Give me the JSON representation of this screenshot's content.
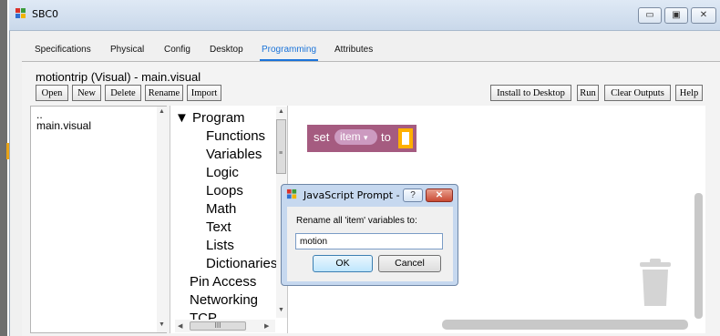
{
  "window": {
    "title": "SBC0",
    "minimize_glyph": "▭",
    "maximize_glyph": "▣",
    "close_glyph": "✕"
  },
  "tabs": [
    {
      "label": "Specifications"
    },
    {
      "label": "Physical"
    },
    {
      "label": "Config"
    },
    {
      "label": "Desktop"
    },
    {
      "label": "Programming",
      "active": true
    },
    {
      "label": "Attributes"
    }
  ],
  "editor": {
    "file_title": "motiontrip (Visual) - main.visual",
    "toolbar_left": [
      "Open",
      "New",
      "Delete",
      "Rename",
      "Import"
    ],
    "toolbar_right": [
      "Install to Desktop",
      "Run",
      "Clear Outputs",
      "Help"
    ]
  },
  "files": {
    "items": [
      "..",
      "main.visual"
    ]
  },
  "categories": {
    "program_label": "▼ Program",
    "program_children": [
      "Functions",
      "Variables",
      "Logic",
      "Loops",
      "Math",
      "Text",
      "Lists",
      "Dictionaries"
    ],
    "top_level": [
      "Pin Access",
      "Networking",
      "TCP"
    ],
    "hscroll_grip": "III"
  },
  "block": {
    "prefix": "set",
    "variable": "item",
    "dropdown_glyph": "▾",
    "suffix": "to",
    "color": "#a55b80"
  },
  "dialog": {
    "title": "JavaScript Prompt -",
    "help_glyph": "?",
    "close_glyph": "✕",
    "prompt": "Rename all 'item' variables to:",
    "input_value": "motion",
    "ok": "OK",
    "cancel": "Cancel"
  },
  "colors": {
    "active_tab": "#1a73d9",
    "block": "#a55b80",
    "block_socket": "#ffb000"
  },
  "icons": [
    "app-icon",
    "trash-icon",
    "dialog-app-icon"
  ]
}
